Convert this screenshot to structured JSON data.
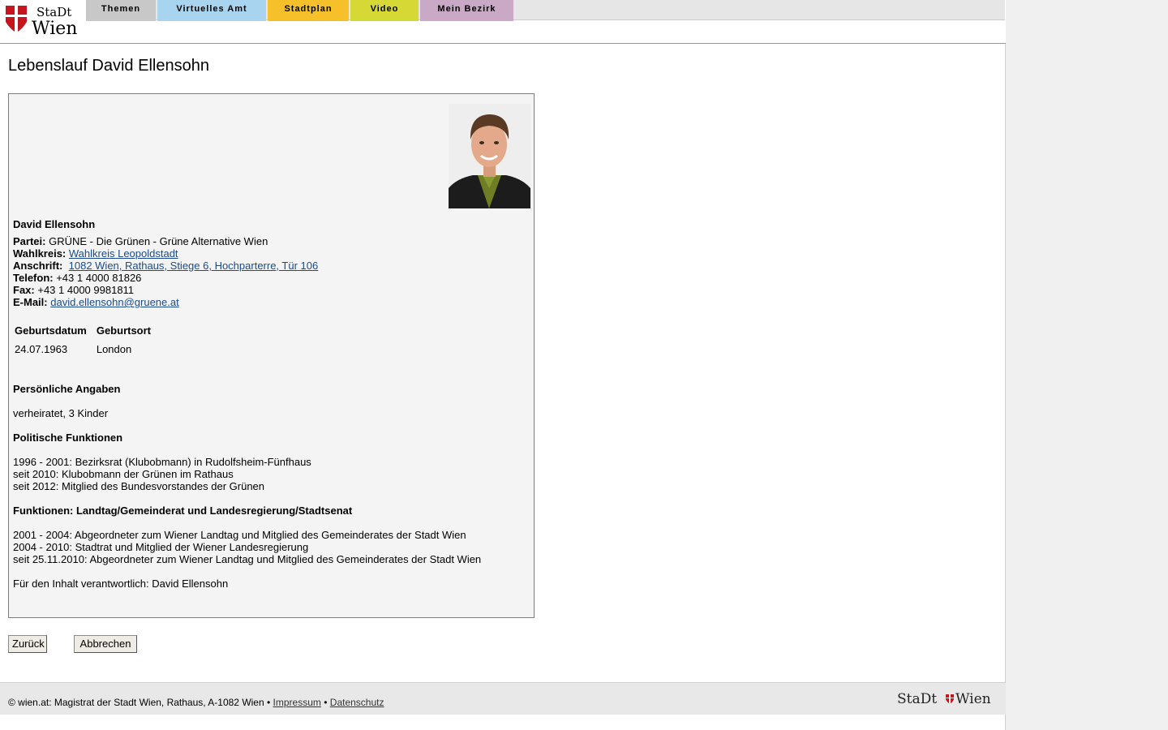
{
  "brand": {
    "line1": "StaDt",
    "line2": "Wien"
  },
  "nav": {
    "tabs": [
      {
        "label": "Themen",
        "color": "#c8c8c8"
      },
      {
        "label": "Virtuelles Amt",
        "color": "#a9d4f0"
      },
      {
        "label": "Stadtplan",
        "color": "#f5c02a"
      },
      {
        "label": "Video",
        "color": "#d6d935"
      },
      {
        "label": "Mein Bezirk",
        "color": "#c9a9c6"
      }
    ]
  },
  "page_title": "Lebenslauf David Ellensohn",
  "person": {
    "name": "David Ellensohn",
    "partei_label": "Partei:",
    "partei": "GRÜNE - Die Grünen - Grüne Alternative Wien",
    "wahlkreis_label": "Wahlkreis:",
    "wahlkreis": "Wahlkreis Leopoldstadt",
    "anschrift_label": "Anschrift:",
    "anschrift": "1082 Wien, Rathaus, Stiege 6, Hochparterre, Tür 106",
    "telefon_label": "Telefon:",
    "telefon": "+43 1 4000 81826",
    "fax_label": "Fax:",
    "fax": "+43 1 4000 9981811",
    "email_label": "E-Mail:",
    "email": "david.ellensohn@gruene.at"
  },
  "birth_table": {
    "headers": [
      "Geburtsdatum",
      "Geburtsort"
    ],
    "row": [
      "24.07.1963",
      "London"
    ]
  },
  "sections": {
    "personal_heading": "Persönliche Angaben",
    "personal_text": "verheiratet, 3 Kinder",
    "political_heading": "Politische Funktionen",
    "political_lines": [
      "1996 - 2001: Bezirksrat (Klubobmann) in Rudolfsheim-Fünfhaus",
      "seit 2010: Klubobmann der Grünen im Rathaus",
      "seit 2012: Mitglied des Bundesvorstandes der Grünen"
    ],
    "functions_heading": "Funktionen: Landtag/Gemeinderat und Landesregierung/Stadtsenat",
    "functions_lines": [
      "2001 - 2004: Abgeordneter zum Wiener Landtag und Mitglied des Gemeinderates der Stadt Wien",
      "2004 - 2010: Stadtrat und Mitglied der Wiener Landesregierung",
      "seit 25.11.2010: Abgeordneter zum Wiener Landtag und Mitglied des Gemeinderates der Stadt Wien"
    ],
    "responsible": "Für den Inhalt verantwortlich: David Ellensohn"
  },
  "buttons": {
    "back": "Zurück",
    "cancel": "Abbrechen"
  },
  "footer": {
    "copyright": "© wien.at: Magistrat der Stadt Wien, Rathaus, A-1082 Wien",
    "sep": "•",
    "impressum": "Impressum",
    "datenschutz": "Datenschutz",
    "logo_left": "StaDt",
    "logo_right": "Wien"
  },
  "colors": {
    "brand_red": "#c4161c",
    "link": "#1a4c8c"
  }
}
